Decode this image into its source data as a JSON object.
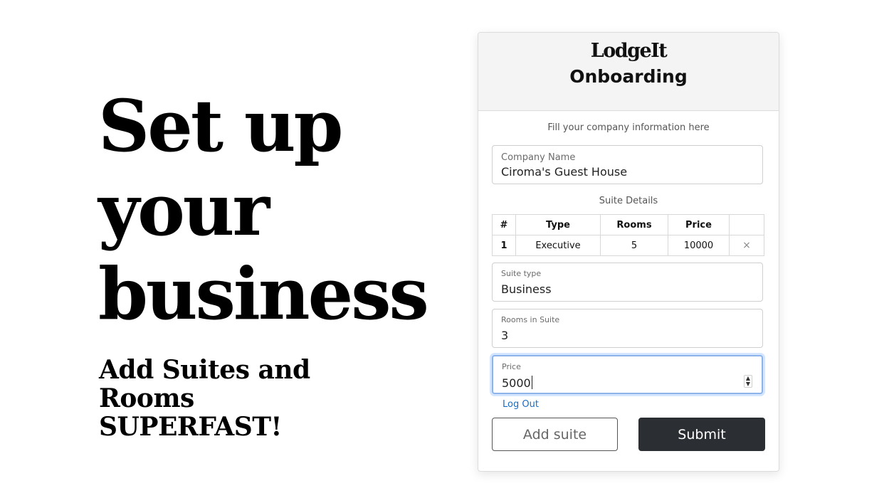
{
  "hero": {
    "lines": [
      "Set up",
      "your",
      "business"
    ],
    "tagline_lines": [
      "Add Suites and Rooms",
      "SUPERFAST!"
    ]
  },
  "card": {
    "brand": "LodgeIt",
    "title": "Onboarding",
    "subtitle": "Fill your company information here",
    "company": {
      "label": "Company Name",
      "value": "Ciroma's Guest House"
    },
    "suite_details_label": "Suite Details",
    "table": {
      "headers": [
        "#",
        "Type",
        "Rooms",
        "Price",
        ""
      ],
      "rows": [
        {
          "num": "1",
          "type": "Executive",
          "rooms": "5",
          "price": "10000",
          "remove": "×"
        }
      ]
    },
    "suite_type": {
      "label": "Suite type",
      "value": "Business"
    },
    "rooms_in_suite": {
      "label": "Rooms in Suite",
      "value": "3"
    },
    "price": {
      "label": "Price",
      "value": "5000"
    },
    "logout_label": "Log Out",
    "add_suite_label": "Add suite",
    "submit_label": "Submit"
  },
  "icons": {
    "remove": "close-icon",
    "spinner": "number-spinner-icon"
  },
  "colors": {
    "accent": "#1a6cc4",
    "submit_bg": "#2b2f33",
    "focus_ring": "#8db4ea"
  }
}
